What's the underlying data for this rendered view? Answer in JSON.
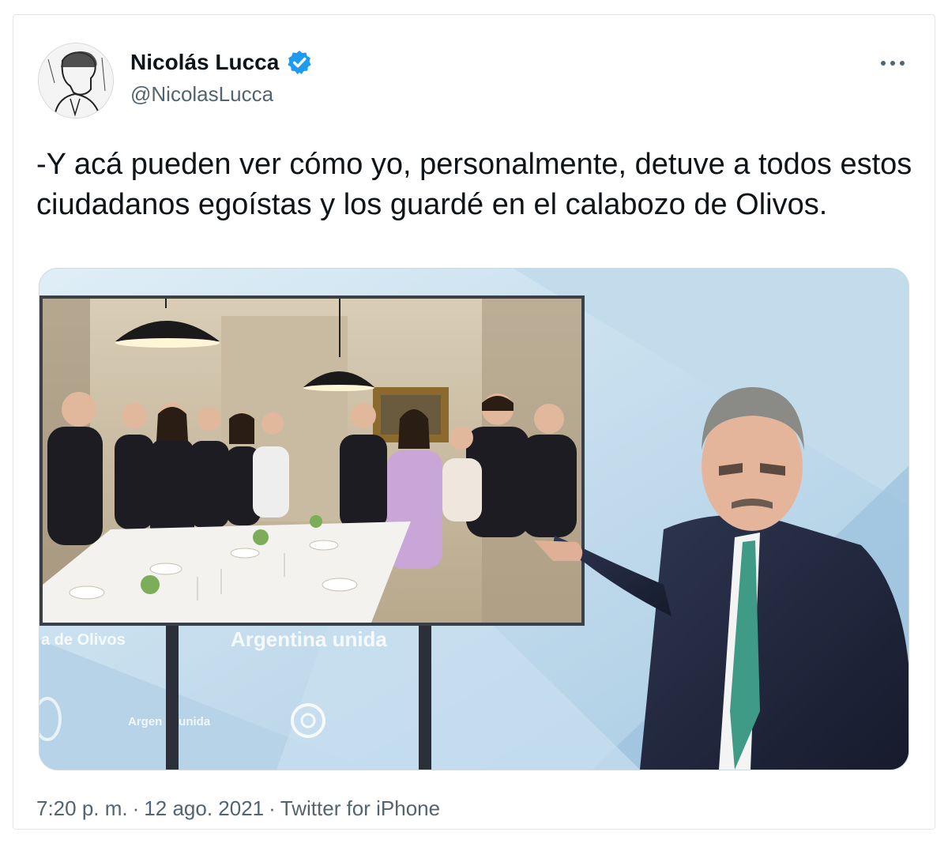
{
  "author": {
    "display_name": "Nicolás Lucca",
    "handle": "@NicolasLucca",
    "verified_icon": "verified-badge-icon",
    "avatar_icon": "avatar-sketch"
  },
  "menu": {
    "icon": "more-options-icon"
  },
  "tweet": {
    "text": "-Y acá pueden ver cómo yo, personalmente, detuve a todos estos ciudadanos egoístas y los guardé en el calabozo de Olivos."
  },
  "media": {
    "left_caption": "a de Olivos",
    "center_caption": "Argentina unida",
    "small_caption": "Argen     unida"
  },
  "meta": {
    "time": "7:20 p. m.",
    "date": "12 ago. 2021",
    "source": "Twitter for iPhone"
  },
  "colors": {
    "accent": "#1d9bf0",
    "text": "#0f1419",
    "secondary": "#536471"
  }
}
